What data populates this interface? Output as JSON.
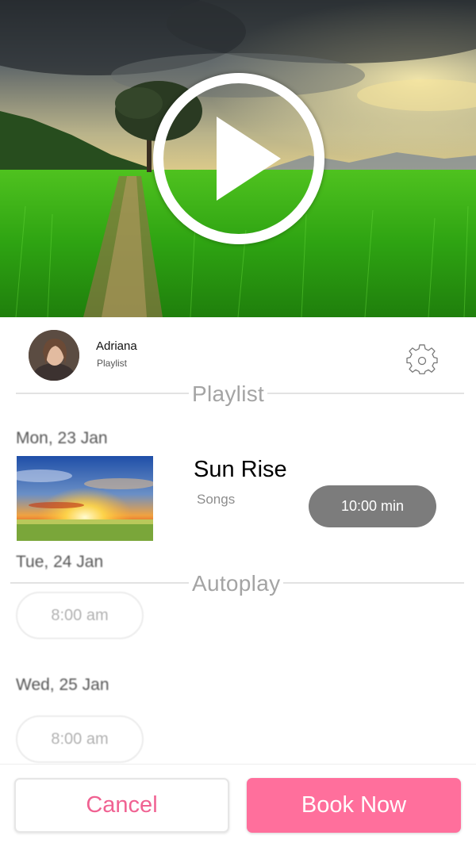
{
  "user": {
    "name": "Adriana",
    "subtitle": "Playlist"
  },
  "sections": {
    "playlist_title": "Playlist",
    "autoplay_title": "Autoplay"
  },
  "days": [
    {
      "label": "Mon, 23 Jan",
      "song_title": "Sun Rise",
      "song_sub": "Songs",
      "duration": "10:00 min"
    },
    {
      "label": "Tue, 24 Jan",
      "time": "8:00 am"
    },
    {
      "label": "Wed, 25 Jan",
      "time": "8:00 am"
    }
  ],
  "actions": {
    "cancel_label": "Cancel",
    "book_label": "Book Now"
  },
  "colors": {
    "accent": "#ff6f9c",
    "cancel_text": "#f06292",
    "pill_bg": "#7c7c7c"
  },
  "icons": {
    "play": "play-icon",
    "settings": "gear-icon"
  }
}
